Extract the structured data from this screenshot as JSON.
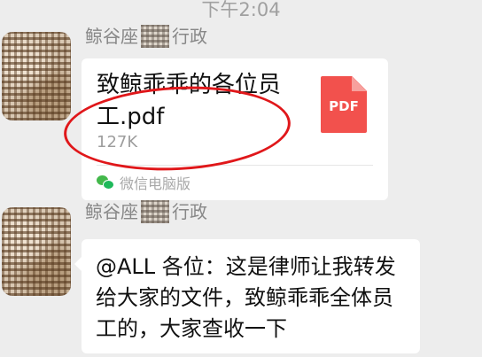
{
  "timestamp": "下午2:04",
  "messages": [
    {
      "sender_prefix": "鲸谷座",
      "sender_suffix": "行政",
      "file": {
        "name": "致鲸乖乖的各位员工.pdf",
        "size": "127K",
        "icon_label": "PDF",
        "source": "微信电脑版"
      }
    },
    {
      "sender_prefix": "鲸谷座",
      "sender_suffix": "行政",
      "text": "@ALL 各位：这是律师让我转发给大家的文件，致鲸乖乖全体员工的，大家查收一下"
    }
  ],
  "colors": {
    "background": "#ededed",
    "bubble": "#ffffff",
    "pdf_icon": "#f2514d",
    "annotation_oval": "#e0171a",
    "wechat_green": "#43b84b"
  }
}
